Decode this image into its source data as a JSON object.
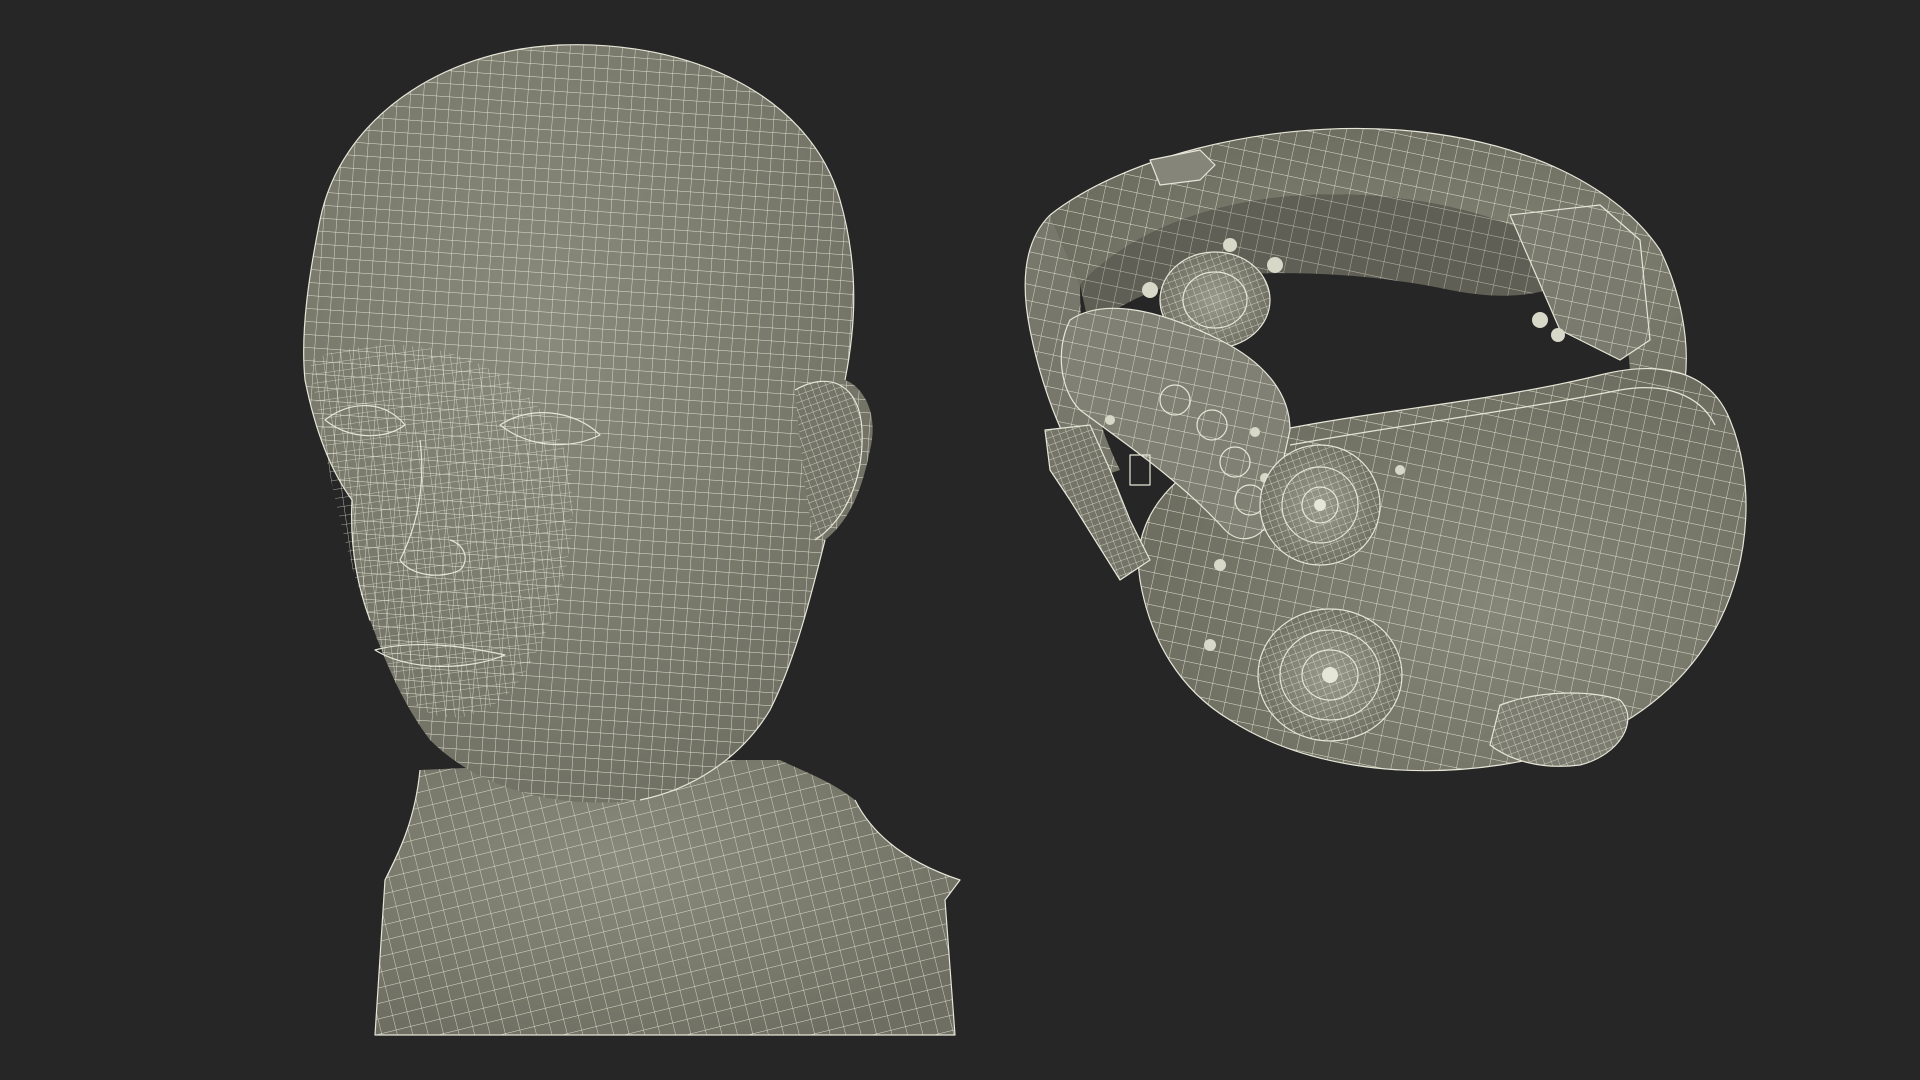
{
  "scene": {
    "background_color": "#262626",
    "mesh_fill_color": "#7d7d70",
    "mesh_shadow_color": "#6b6b60",
    "wire_color": "#e6e6d8",
    "objects": [
      {
        "name": "head-wireframe-model",
        "icon": "human-head-mesh"
      },
      {
        "name": "headband-device-wireframe-model",
        "icon": "neural-headset-mesh"
      }
    ]
  }
}
